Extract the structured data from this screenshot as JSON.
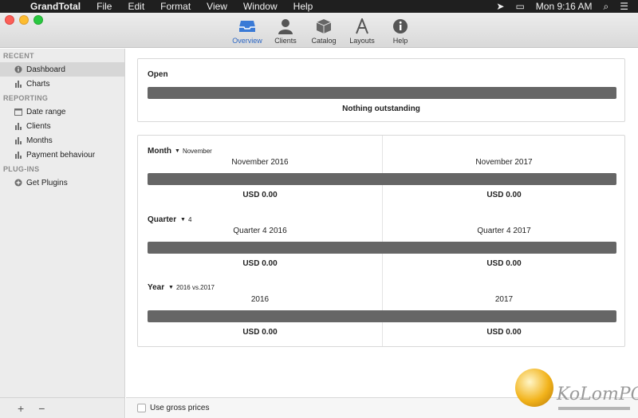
{
  "menubar": {
    "app_name": "GrandTotal",
    "items": [
      "File",
      "Edit",
      "Format",
      "View",
      "Window",
      "Help"
    ],
    "clock": "Mon 9:16 AM"
  },
  "toolbar": {
    "items": [
      {
        "label": "Overview",
        "icon": "inbox-tray-icon",
        "active": true
      },
      {
        "label": "Clients",
        "icon": "person-icon"
      },
      {
        "label": "Catalog",
        "icon": "box-icon"
      },
      {
        "label": "Layouts",
        "icon": "layouts-icon"
      },
      {
        "label": "Help",
        "icon": "info-icon"
      }
    ]
  },
  "sidebar": {
    "recent_header": "RECENT",
    "recent": [
      {
        "label": "Dashboard",
        "icon": "info-circle-icon"
      },
      {
        "label": "Charts",
        "icon": "bar-chart-icon"
      }
    ],
    "reporting_header": "REPORTING",
    "reporting": [
      {
        "label": "Date range",
        "icon": "calendar-icon"
      },
      {
        "label": "Clients",
        "icon": "bar-chart-icon"
      },
      {
        "label": "Months",
        "icon": "bar-chart-icon"
      },
      {
        "label": "Payment behaviour",
        "icon": "bar-chart-icon"
      }
    ],
    "plugins_header": "PLUG-INS",
    "plugins": [
      {
        "label": "Get Plugins",
        "icon": "plus-circle-icon"
      }
    ],
    "footer_add": "+",
    "footer_remove": "−"
  },
  "main": {
    "open": {
      "title": "Open",
      "status": "Nothing outstanding"
    },
    "month": {
      "label": "Month",
      "selected": "November",
      "left_title": "November 2016",
      "right_title": "November 2017",
      "left_value": "USD 0.00",
      "right_value": "USD 0.00"
    },
    "quarter": {
      "label": "Quarter",
      "selected": "4",
      "left_title": "Quarter 4 2016",
      "right_title": "Quarter 4 2017",
      "left_value": "USD 0.00",
      "right_value": "USD 0.00"
    },
    "year": {
      "label": "Year",
      "selected": "2016 vs.2017",
      "left_title": "2016",
      "right_title": "2017",
      "left_value": "USD 0.00",
      "right_value": "USD 0.00"
    },
    "gross_prices_label": "Use gross prices"
  },
  "watermark": {
    "text": "KoLomPC"
  },
  "colors": {
    "accent": "#2b66c4",
    "bar": "#666666",
    "sidebar_bg": "#ececec"
  }
}
